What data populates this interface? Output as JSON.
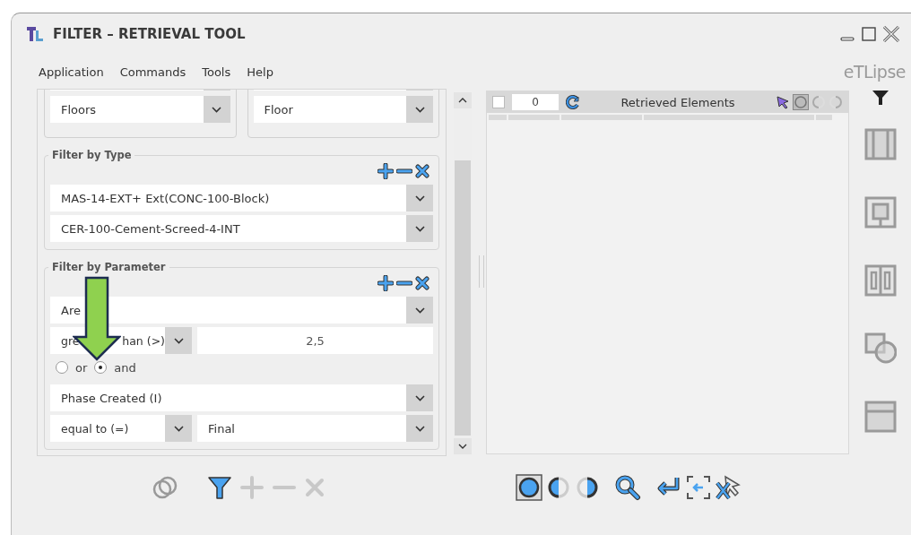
{
  "window": {
    "title": "FILTER – RETRIEVAL TOOL"
  },
  "menu": [
    {
      "label": "Application"
    },
    {
      "label": "Commands"
    },
    {
      "label": "Tools"
    },
    {
      "label": "Help"
    }
  ],
  "brand": "eTLipse",
  "filter_panel": {
    "top_selects": [
      {
        "value": "Floors"
      },
      {
        "value": "Floor"
      }
    ],
    "groups": [
      {
        "title": "Filter by Type",
        "rows": [
          {
            "kind": "select",
            "value": "MAS-14-EXT+ Ext(CONC-100-Block)"
          },
          {
            "kind": "select",
            "value": "CER-100-Cement-Screed-4-INT"
          }
        ]
      },
      {
        "title": "Filter by Parameter",
        "rows": [
          {
            "kind": "select",
            "value": "Are"
          },
          {
            "kind": "condition",
            "operator_parts": [
              "gre",
              "han (>)"
            ],
            "value": {
              "kind": "input",
              "text": "2,5"
            }
          },
          {
            "kind": "logic",
            "options": [
              {
                "label": "or",
                "selected": false
              },
              {
                "label": "and",
                "selected": true
              }
            ]
          },
          {
            "kind": "select",
            "value": "Phase Created (I)"
          },
          {
            "kind": "condition",
            "operator_parts": [
              "equal to (=)"
            ],
            "value": {
              "kind": "select",
              "text": "Final"
            }
          }
        ]
      }
    ]
  },
  "results": {
    "checked": false,
    "count": "0",
    "title": "Retrieved Elements"
  }
}
